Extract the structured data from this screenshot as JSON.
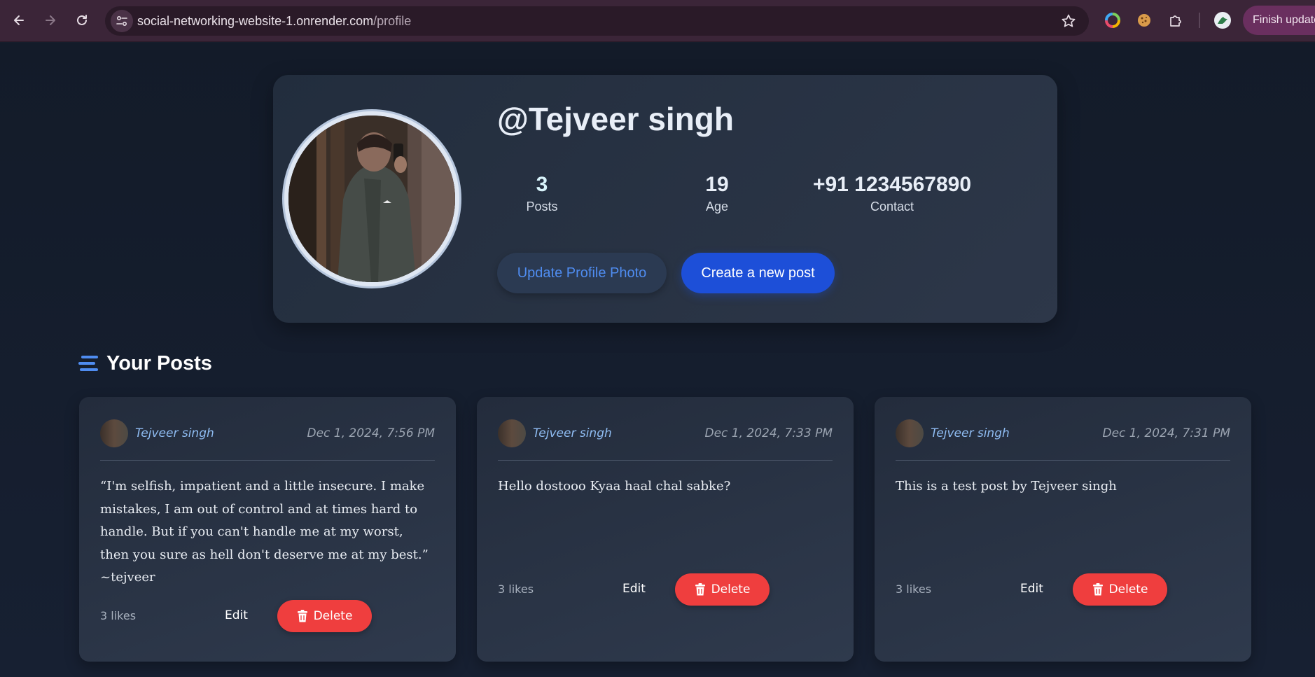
{
  "browser": {
    "url_host": "social-networking-website-1.onrender.com",
    "url_path": "/profile",
    "finish_update_label": "Finish update",
    "icons": [
      "back-icon",
      "forward-icon",
      "reload-icon",
      "site-settings-icon",
      "bookmark-star-icon",
      "color-wheel-extension-icon",
      "cookie-extension-icon",
      "extensions-puzzle-icon",
      "profile-avatar-icon"
    ]
  },
  "profile": {
    "username": "@Tejveer singh",
    "stats": [
      {
        "value": "3",
        "label": "Posts",
        "color": "#d8f3fb"
      },
      {
        "value": "19",
        "label": "Age",
        "color": "#e8eef7"
      },
      {
        "value": "+91 1234567890",
        "label": "Contact",
        "color": "#e8eef7"
      }
    ],
    "update_photo_label": "Update Profile Photo",
    "create_post_label": "Create a new post"
  },
  "posts_section": {
    "title": "Your Posts",
    "icon": "menu-bars-icon",
    "accent_color": "#4f8cf0"
  },
  "posts": [
    {
      "author": "Tejveer singh",
      "time": "Dec 1, 2024, 7:56 PM",
      "content": "“I'm selfish, impatient and a little insecure. I make mistakes, I am out of control and at times hard to handle. But if you can't handle me at my worst, then you sure as hell don't deserve me at my best.” ~tejveer",
      "likes": "3 likes",
      "edit_label": "Edit",
      "delete_label": "Delete"
    },
    {
      "author": "Tejveer singh",
      "time": "Dec 1, 2024, 7:33 PM",
      "content": "Hello dostooo Kyaa haal chal sabke?",
      "likes": "3 likes",
      "edit_label": "Edit",
      "delete_label": "Delete"
    },
    {
      "author": "Tejveer singh",
      "time": "Dec 1, 2024, 7:31 PM",
      "content": "This is a test post by Tejveer singh",
      "likes": "3 likes",
      "edit_label": "Edit",
      "delete_label": "Delete"
    }
  ]
}
